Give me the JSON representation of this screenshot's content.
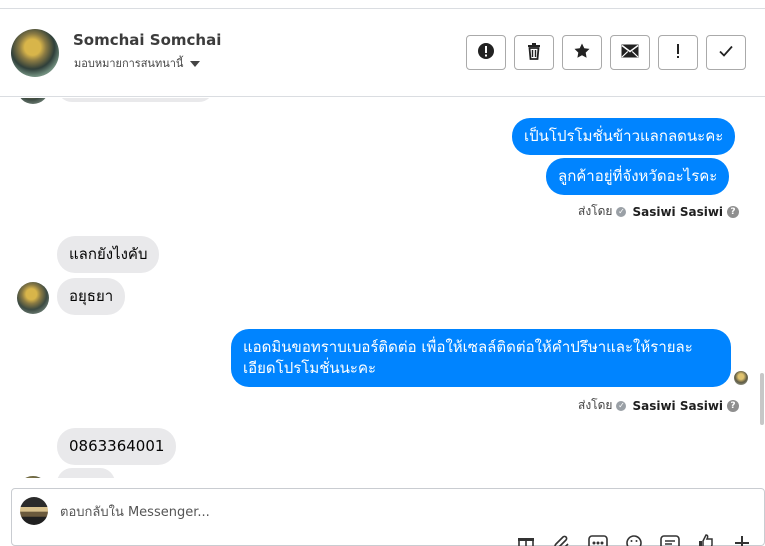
{
  "contact": {
    "name": "Somchai Somchai",
    "assign_label": "มอบหมายการสนทนานี้"
  },
  "actions": [
    {
      "name": "report-spam-button",
      "icon": "alert-circle-icon"
    },
    {
      "name": "delete-button",
      "icon": "trash-icon"
    },
    {
      "name": "star-button",
      "icon": "star-icon"
    },
    {
      "name": "mark-unread-button",
      "icon": "envelope-icon"
    },
    {
      "name": "follow-up-button",
      "icon": "exclamation-icon"
    },
    {
      "name": "mark-done-button",
      "icon": "check-icon"
    }
  ],
  "messages": {
    "out_1": "เป็นโปรโมชั่นข้าวแลกลดนะคะ",
    "out_2": "ลูกค้าอยู่ที่จังหวัดอะไรคะ",
    "sent_by_1": {
      "prefix": "ส่งโดย",
      "agent": "Sasiwi Sasiwi"
    },
    "in_1": "แลกยังไงคับ",
    "in_2": "อยุธยา",
    "out_3_line1": "แอดมินขอทราบเบอร์ติดต่อ เพื่อให้เซลล์ติดต่อให้คำปรึษาและให้รายละ",
    "out_3_line2": "เอียดโปรโมชั่นนะคะ",
    "sent_by_2": {
      "prefix": "ส่งโดย",
      "agent": "Sasiwi Sasiwi"
    },
    "in_3": "0863364001"
  },
  "composer": {
    "placeholder": "ตอบกลับใน Messenger..."
  },
  "colors": {
    "outgoing_bubble": "#0084ff",
    "incoming_bubble": "#e9e9eb"
  }
}
